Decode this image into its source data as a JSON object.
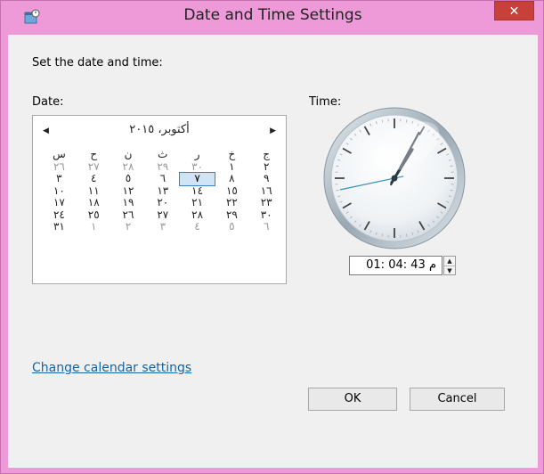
{
  "window": {
    "title": "Date and Time Settings",
    "close_symbol": "✕"
  },
  "prompt": "Set the date and time:",
  "date_label": "Date:",
  "time_label": "Time:",
  "calendar": {
    "month_label": "أكتوبر، ٢٠١٥",
    "prev_arrow": "◀",
    "next_arrow": "▶",
    "weekday_headers": [
      "س",
      "ح",
      "ن",
      "ث",
      "ر",
      "خ",
      "ج"
    ],
    "weeks": [
      [
        {
          "d": "٢٦",
          "o": true
        },
        {
          "d": "٢٧",
          "o": true
        },
        {
          "d": "٢٨",
          "o": true
        },
        {
          "d": "٢٩",
          "o": true
        },
        {
          "d": "٣٠",
          "o": true
        },
        {
          "d": "١",
          "o": false
        },
        {
          "d": "٢",
          "o": false
        }
      ],
      [
        {
          "d": "٣",
          "o": false
        },
        {
          "d": "٤",
          "o": false
        },
        {
          "d": "٥",
          "o": false
        },
        {
          "d": "٦",
          "o": false
        },
        {
          "d": "٧",
          "o": false,
          "sel": true
        },
        {
          "d": "٨",
          "o": false
        },
        {
          "d": "٩",
          "o": false
        }
      ],
      [
        {
          "d": "١٠",
          "o": false
        },
        {
          "d": "١١",
          "o": false
        },
        {
          "d": "١٢",
          "o": false
        },
        {
          "d": "١٣",
          "o": false
        },
        {
          "d": "١٤",
          "o": false
        },
        {
          "d": "١٥",
          "o": false
        },
        {
          "d": "١٦",
          "o": false
        }
      ],
      [
        {
          "d": "١٧",
          "o": false
        },
        {
          "d": "١٨",
          "o": false
        },
        {
          "d": "١٩",
          "o": false
        },
        {
          "d": "٢٠",
          "o": false
        },
        {
          "d": "٢١",
          "o": false
        },
        {
          "d": "٢٢",
          "o": false
        },
        {
          "d": "٢٣",
          "o": false
        }
      ],
      [
        {
          "d": "٢٤",
          "o": false
        },
        {
          "d": "٢٥",
          "o": false
        },
        {
          "d": "٢٦",
          "o": false
        },
        {
          "d": "٢٧",
          "o": false
        },
        {
          "d": "٢٨",
          "o": false
        },
        {
          "d": "٢٩",
          "o": false
        },
        {
          "d": "٣٠",
          "o": false
        }
      ],
      [
        {
          "d": "٣١",
          "o": false
        },
        {
          "d": "١",
          "o": true
        },
        {
          "d": "٢",
          "o": true
        },
        {
          "d": "٣",
          "o": true
        },
        {
          "d": "٤",
          "o": true
        },
        {
          "d": "٥",
          "o": true
        },
        {
          "d": "٦",
          "o": true
        }
      ]
    ]
  },
  "clock": {
    "hour": 1,
    "minute": 4,
    "second": 43
  },
  "time_value": "01: 04: 43 م",
  "spinner": {
    "up": "▲",
    "down": "▼"
  },
  "change_calendar_link": "Change calendar settings",
  "buttons": {
    "ok": "OK",
    "cancel": "Cancel"
  },
  "colors": {
    "frame": "#ee9ad8",
    "close": "#c8403a",
    "link": "#1565a8",
    "selection": "#cfe4f7"
  }
}
